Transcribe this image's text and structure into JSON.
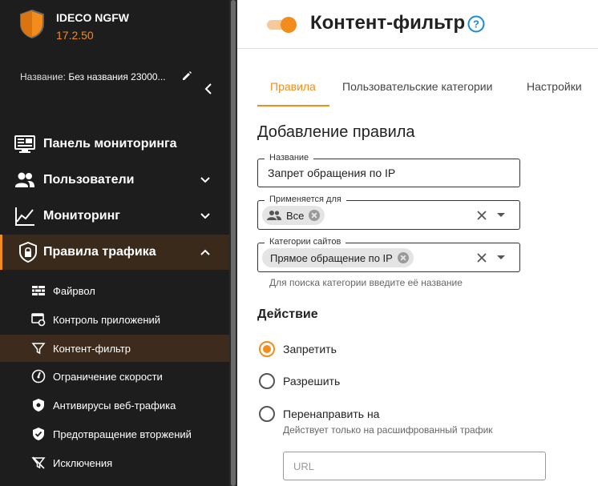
{
  "brand": {
    "name": "IDECO NGFW",
    "version": "17.2.50"
  },
  "config": {
    "label": "Название:",
    "value": "Без названия 23000..."
  },
  "nav": [
    {
      "label": "Панель мониторинга"
    },
    {
      "label": "Пользователи"
    },
    {
      "label": "Мониторинг"
    },
    {
      "label": "Правила трафика"
    }
  ],
  "subnav": [
    {
      "label": "Файрвол"
    },
    {
      "label": "Контроль приложений"
    },
    {
      "label": "Контент-фильтр"
    },
    {
      "label": "Ограничение скорости"
    },
    {
      "label": "Антивирусы веб-трафика"
    },
    {
      "label": "Предотвращение вторжений"
    },
    {
      "label": "Исключения"
    }
  ],
  "header": {
    "title": "Контент-фильтр",
    "enabled": true
  },
  "tabs": [
    {
      "label": "Правила"
    },
    {
      "label": "Пользовательские категории"
    },
    {
      "label": "Настройки"
    }
  ],
  "form": {
    "title": "Добавление правила",
    "name": {
      "label": "Название",
      "value": "Запрет обращения по IP"
    },
    "applies": {
      "label": "Применяется для",
      "chip": "Все"
    },
    "categories": {
      "label": "Категории сайтов",
      "chip": "Прямое обращение по IP",
      "hint": "Для поиска категории введите её название"
    },
    "action": {
      "title": "Действие",
      "options": [
        {
          "label": "Запретить",
          "checked": true
        },
        {
          "label": "Разрешить",
          "checked": false
        },
        {
          "label": "Перенаправить на",
          "checked": false
        }
      ],
      "redirect_hint": "Действует только на расшифрованный трафик",
      "url_placeholder": "URL"
    }
  },
  "colors": {
    "accent": "#f28c1c",
    "sidebar_bg": "#1d1d1d",
    "active_bg": "#3a2a1c"
  }
}
